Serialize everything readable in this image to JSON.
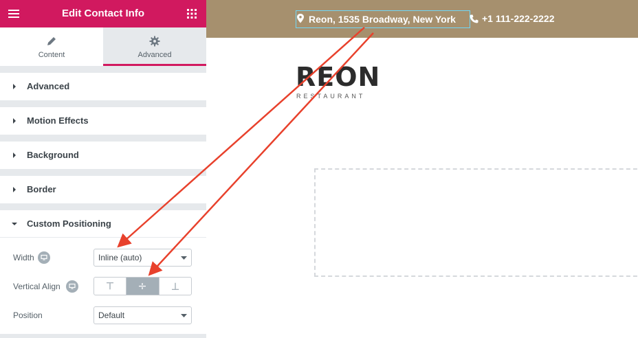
{
  "sidebar": {
    "header_title": "Edit Contact Info",
    "tabs": [
      {
        "label": "Content",
        "icon": "pencil-icon",
        "active": false
      },
      {
        "label": "Advanced",
        "icon": "gear-icon",
        "active": true
      }
    ],
    "sections": [
      {
        "label": "Advanced",
        "expanded": false
      },
      {
        "label": "Motion Effects",
        "expanded": false
      },
      {
        "label": "Background",
        "expanded": false
      },
      {
        "label": "Border",
        "expanded": false
      },
      {
        "label": "Custom Positioning",
        "expanded": true
      }
    ],
    "controls": {
      "width": {
        "label": "Width",
        "value": "Inline (auto)"
      },
      "vertical_align": {
        "label": "Vertical Align",
        "options": [
          "top",
          "middle",
          "bottom"
        ],
        "selected": "middle"
      },
      "position": {
        "label": "Position",
        "value": "Default"
      }
    },
    "accent_color": "#d1195f"
  },
  "preview": {
    "topbar": {
      "address": "Reon, 1535 Broadway, New York",
      "phone": "+1 111-222-2222",
      "background": "#a6906e"
    },
    "logo": {
      "title": "REON",
      "subtitle": "RESTAURANT"
    },
    "annotation_color": "#e8412c"
  }
}
